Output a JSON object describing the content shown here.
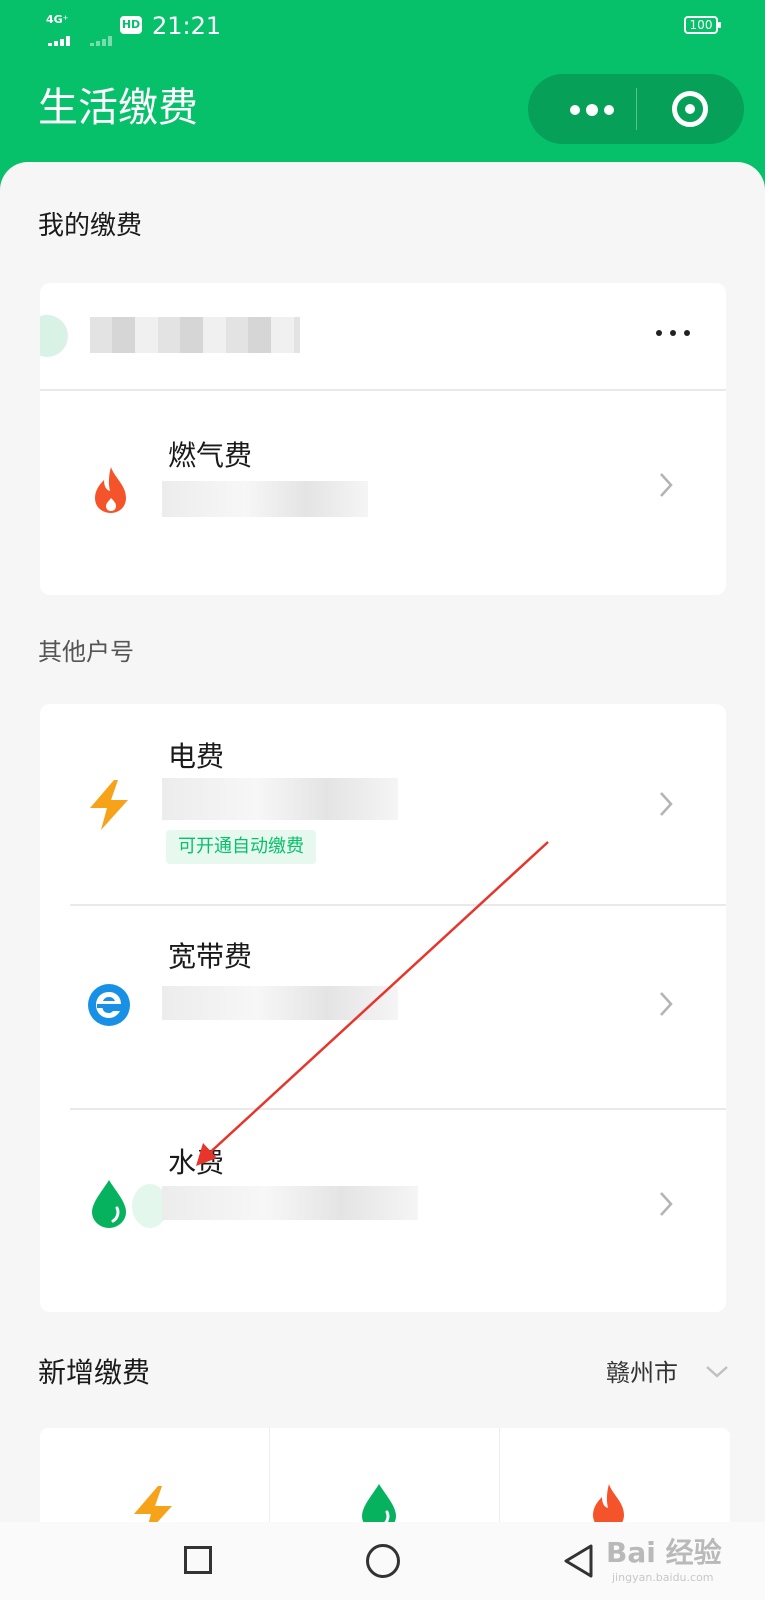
{
  "status_bar": {
    "network": "4G⁺",
    "hd": "HD",
    "time": "21:21",
    "battery": "100"
  },
  "header": {
    "title": "生活缴费"
  },
  "my_payments": {
    "heading": "我的缴费",
    "gas": {
      "label": "燃气费",
      "icon": "flame-icon",
      "icon_color": "#f5542a"
    }
  },
  "other_accounts": {
    "heading": "其他户号",
    "items": [
      {
        "label": "电费",
        "icon": "lightning-icon",
        "icon_color": "#f7a31a",
        "tag": "可开通自动缴费"
      },
      {
        "label": "宽带费",
        "icon": "broadband-e-icon",
        "icon_color": "#1890e6"
      },
      {
        "label": "水费",
        "icon": "water-drop-icon",
        "icon_color": "#07b25f"
      }
    ]
  },
  "new_payment": {
    "heading": "新增缴费",
    "city": "赣州市",
    "grid_icons": [
      "lightning-icon",
      "water-drop-icon",
      "flame-icon"
    ]
  },
  "colors": {
    "brand_green": "#07c16a",
    "capsule_green": "#06a058",
    "arrow_red": "#e8352b"
  },
  "watermark": {
    "text": "Bai 经验",
    "sub": "jingyan.baidu.com"
  }
}
